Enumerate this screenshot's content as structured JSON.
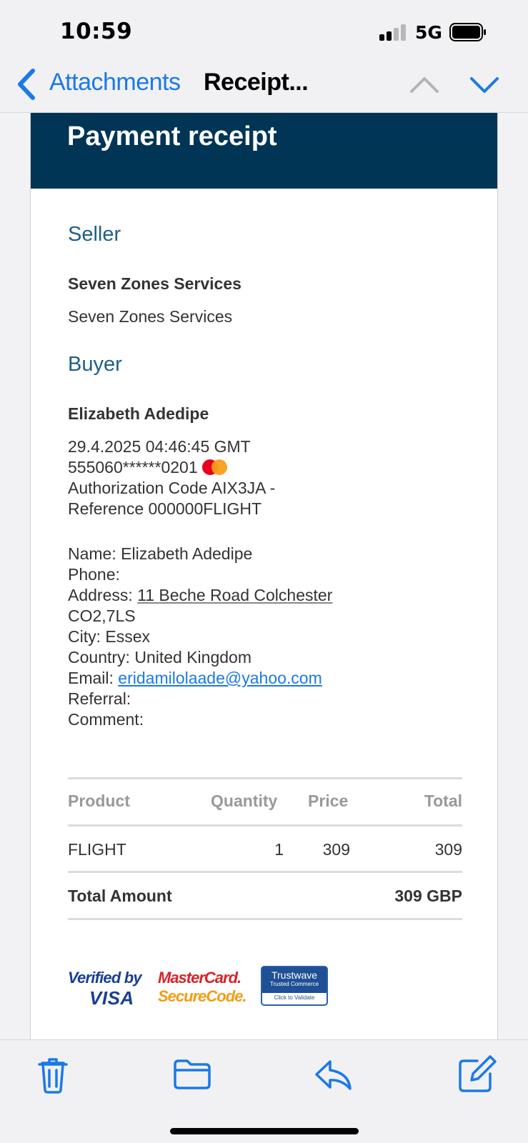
{
  "status_bar": {
    "time": "10:59",
    "network": "5G"
  },
  "nav": {
    "back_label": "Attachments",
    "title": "Receipt..."
  },
  "receipt": {
    "title": "Payment receipt",
    "seller_heading": "Seller",
    "seller_name": "Seven Zones Services",
    "seller_line": "Seven Zones Services",
    "buyer_heading": "Buyer",
    "buyer_name": "Elizabeth Adedipe",
    "datetime": "29.4.2025 04:46:45 GMT",
    "card_number": "555060******0201",
    "auth_line": "Authorization Code AIX3JA -",
    "reference_line": "Reference 000000FLIGHT",
    "name_label": "Name:",
    "name_value": "Elizabeth Adedipe",
    "phone_label": "Phone:",
    "address_label": "Address:",
    "address_value": "11 Beche Road Colchester",
    "address_cont": "CO2,7LS",
    "city_label": "City:",
    "city_value": "Essex",
    "country_label": "Country:",
    "country_value": "United Kingdom",
    "email_label": "Email:",
    "email_value": "eridamilolaade@yahoo.com",
    "referral_label": "Referral:",
    "comment_label": "Comment:"
  },
  "table": {
    "headers": {
      "product": "Product",
      "quantity": "Quantity",
      "price": "Price",
      "total": "Total"
    },
    "rows": [
      {
        "product": "FLIGHT",
        "quantity": "1",
        "price": "309",
        "total": "309"
      }
    ],
    "total_label": "Total Amount",
    "total_value": "309 GBP"
  },
  "logos": {
    "visa_line1": "Verified by",
    "visa_line2": "VISA",
    "mc_line1": "MasterCard.",
    "mc_line2": "SecureCode.",
    "tw_name": "Trustwave",
    "tw_sub": "Trusted Commerce",
    "tw_bottom": "Click to Validate"
  },
  "colors": {
    "accent": "#1b79e8",
    "header_bg": "#003555",
    "heading": "#1f5f86"
  },
  "icons": [
    "back-chevron-icon",
    "chevron-up-icon",
    "chevron-down-icon",
    "trash-icon",
    "folder-icon",
    "reply-icon",
    "compose-icon"
  ]
}
